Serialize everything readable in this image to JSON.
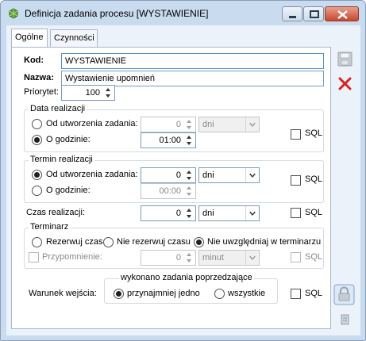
{
  "window": {
    "title": "Definicja zadania procesu [WYSTAWIENIE]"
  },
  "tabs": [
    {
      "label": "Ogólne",
      "active": true
    },
    {
      "label": "Czynności",
      "active": false
    }
  ],
  "form": {
    "kod_label": "Kod:",
    "kod_value": "WYSTAWIENIE",
    "nazwa_label": "Nazwa:",
    "nazwa_value": "Wystawienie upomnień",
    "priorytet_label": "Priorytet:",
    "priorytet_value": "100"
  },
  "data_realizacji": {
    "title": "Data realizacji",
    "od_label": "Od utworzenia zadania:",
    "od_value": "0",
    "od_unit": "dni",
    "o_godzinie_label": "O godzinie:",
    "o_godzinie_value": "01:00",
    "sql_label": "SQL",
    "selected": "o_godzinie"
  },
  "termin_realizacji": {
    "title": "Termin realizacji",
    "od_label": "Od utworzenia zadania:",
    "od_value": "0",
    "od_unit": "dni",
    "o_godzinie_label": "O godzinie:",
    "o_godzinie_value": "00:00",
    "sql_label": "SQL",
    "selected": "od_utworzenia"
  },
  "czas_realizacji": {
    "label": "Czas realizacji:",
    "value": "0",
    "unit": "dni",
    "sql_label": "SQL"
  },
  "terminarz": {
    "title": "Terminarz",
    "opt1": "Rezerwuj czas",
    "opt2": "Nie rezerwuj czasu",
    "opt3": "Nie uwzględniaj w terminarzu",
    "selected": "opt3",
    "przypomnienie_label": "Przypomnienie:",
    "przypomnienie_value": "0",
    "przypomnienie_unit": "minut",
    "sql_label": "SQL"
  },
  "warunek": {
    "label": "Warunek wejścia:",
    "group_title": "wykonano zadania poprzedzające",
    "opt1": "przynajmniej jedno",
    "opt2": "wszystkie",
    "selected": "opt1",
    "sql_label": "SQL"
  },
  "icons": {
    "save": "save-icon",
    "cancel": "cancel-icon",
    "lock": "lock-icon",
    "exit": "exit-icon"
  }
}
